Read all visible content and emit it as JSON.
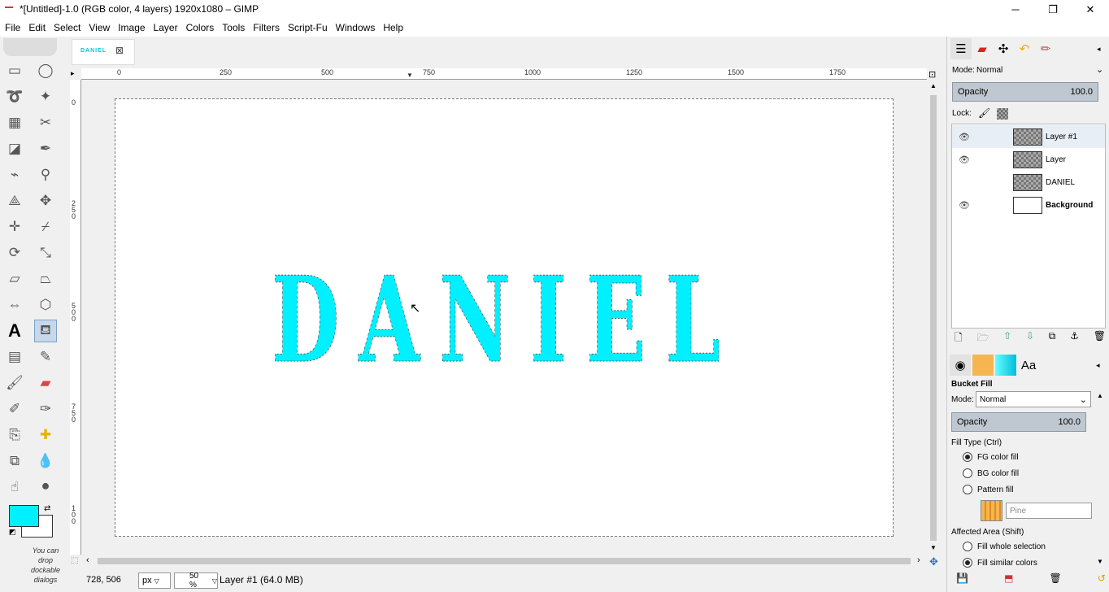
{
  "window": {
    "title": "*[Untitled]-1.0 (RGB color, 4 layers) 1920x1080 – GIMP",
    "minimize": "─",
    "maximize": "❐",
    "close": "✕"
  },
  "menu": [
    "File",
    "Edit",
    "Select",
    "View",
    "Image",
    "Layer",
    "Colors",
    "Tools",
    "Filters",
    "Script-Fu",
    "Windows",
    "Help"
  ],
  "tab": {
    "label": "DANIEL",
    "close": "⊠"
  },
  "rulers": {
    "h": [
      "0",
      "250",
      "500",
      "750",
      "1000",
      "1250",
      "1500",
      "1750"
    ],
    "v": [
      "0",
      "2\n5\n0",
      "5\n0\n0",
      "7\n5\n0",
      "1\n0\n0"
    ]
  },
  "canvas_text": "DANIEL",
  "colors": {
    "fg": "#00f0ff",
    "bg": "#ffffff"
  },
  "toolbox": {
    "hint": "You can drop dockable dialogs"
  },
  "status": {
    "coords": "728, 506",
    "unit": "px",
    "zoom": "50 %",
    "info": "Layer #1 (64.0 MB)"
  },
  "layers_panel": {
    "mode_label": "Mode:",
    "mode": "Normal",
    "opacity_label": "Opacity",
    "opacity": "100.0",
    "lock_label": "Lock:",
    "layers": [
      {
        "name": "Layer #1",
        "visible": true,
        "bold": false
      },
      {
        "name": "Layer",
        "visible": true,
        "bold": false
      },
      {
        "name": "DANIEL",
        "visible": false,
        "bold": false
      },
      {
        "name": "Background",
        "visible": true,
        "bold": true
      }
    ]
  },
  "tool_options": {
    "title": "Bucket Fill",
    "mode_label": "Mode:",
    "mode": "Normal",
    "opacity_label": "Opacity",
    "opacity": "100.0",
    "fill_type_label": "Fill Type  (Ctrl)",
    "fill_types": [
      "FG color fill",
      "BG color fill",
      "Pattern fill"
    ],
    "fill_selected": 0,
    "pattern_name": "Pine",
    "affected_label": "Affected Area  (Shift)",
    "affected": [
      "Fill whole selection",
      "Fill similar colors"
    ],
    "affected_selected": 1
  }
}
